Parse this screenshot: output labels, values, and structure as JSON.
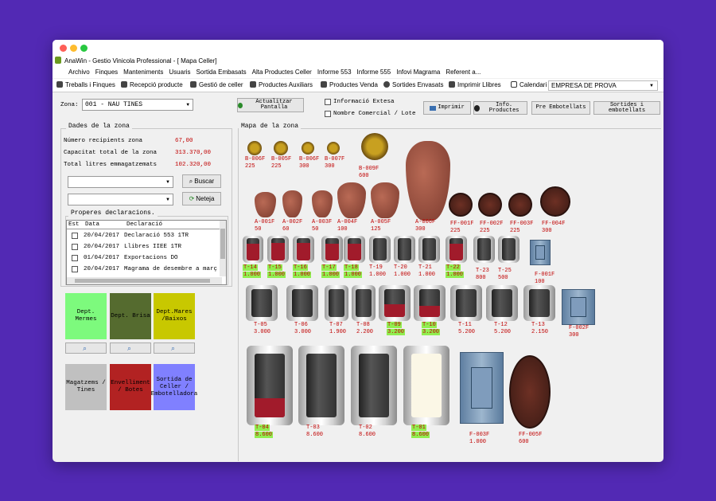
{
  "window": {
    "app_title": "AnaWin - Gestio Vinicola Professional - [  Mapa Celler]"
  },
  "menu": [
    "Archivo",
    "Finques",
    "Manteniments",
    "Usuaris",
    "Sortida Embasats",
    "Alta Productes Celler",
    "Informe 553",
    "Informe 555",
    "Infovi Magrama",
    "Referent a..."
  ],
  "toolbar": {
    "items": [
      "Treballs i Finques",
      "Recepció producte",
      "Gestió de celler",
      "Productes Auxiliars",
      "Productes Venda",
      "Sortides Envasats",
      "Imprimir Llibres",
      "Calendari"
    ],
    "company": "EMPRESA DE PROVA"
  },
  "zone": {
    "label": "Zona:",
    "value": "001 - NAU TINES"
  },
  "actions": {
    "refresh": "Actualitzar Pantalla",
    "info_ext": "Informació Extesa",
    "trade_name": "Nombre Comercial / Lote",
    "print": "Imprimir",
    "info_products": "Info. Productes",
    "pre_bottled": "Pre Embotellats",
    "bottled_out": "Sortides i embotellats"
  },
  "zone_data": {
    "title": "Dades de la zona",
    "rows": [
      {
        "label": "Número recipients zona",
        "value": "67,00"
      },
      {
        "label": "Capacitat total de la zona",
        "value": "313.370,00"
      },
      {
        "label": "Total litres emmagatzemats",
        "value": "102.320,00"
      }
    ]
  },
  "search": {
    "find": "Buscar",
    "clear": "Neteja"
  },
  "declarations": {
    "title": "Properes declaracions.",
    "headers": [
      "Est",
      "Data",
      "Declaració"
    ],
    "rows": [
      {
        "date": "20/04/2017",
        "name": "Declaració 553 1TR"
      },
      {
        "date": "20/04/2017",
        "name": "Llibres IIEE 1TR"
      },
      {
        "date": "01/04/2017",
        "name": "Exportacions DO"
      },
      {
        "date": "20/04/2017",
        "name": "Magrama de desembre a març"
      }
    ]
  },
  "departments": [
    {
      "label": "Dept. Mermes",
      "color": "#7dfa7d"
    },
    {
      "label": "Dept. Brisa",
      "color": "#556b2f"
    },
    {
      "label": "Dept.Mares /Baixos",
      "color": "#c8c800"
    },
    {
      "label": "Magatzems / Tines",
      "color": "#c0c0c0"
    },
    {
      "label": "Envelliment / Botes",
      "color": "#b22222"
    },
    {
      "label": "Sortida de Celler / Embotelladora",
      "color": "#8080ff"
    }
  ],
  "map": {
    "title": "Mapa de la zona",
    "pots": [
      {
        "name": "B-006F",
        "cap": "225"
      },
      {
        "name": "B-005F",
        "cap": "225"
      },
      {
        "name": "B-006F",
        "cap": "300"
      },
      {
        "name": "B-007F",
        "cap": "300"
      },
      {
        "name": "B-009F",
        "cap": "600"
      }
    ],
    "amphorae": [
      {
        "name": "A-001F",
        "cap": "50"
      },
      {
        "name": "A-002F",
        "cap": "60"
      },
      {
        "name": "A-003F",
        "cap": "50"
      },
      {
        "name": "A-004F",
        "cap": "100"
      },
      {
        "name": "A-005F",
        "cap": "125"
      },
      {
        "name": "A-006F",
        "cap": "300"
      }
    ],
    "barrels_top": [
      {
        "name": "FF-001F",
        "cap": "225"
      },
      {
        "name": "FF-002F",
        "cap": "225"
      },
      {
        "name": "FF-003F",
        "cap": "225"
      },
      {
        "name": "FF-004F",
        "cap": "300"
      }
    ],
    "row3": [
      {
        "name": "T-14",
        "cap": "1.000",
        "hl": true
      },
      {
        "name": "T-15",
        "cap": "1.000",
        "hl": true
      },
      {
        "name": "T-16",
        "cap": "1.000",
        "hl": true
      },
      {
        "name": "T-17",
        "cap": "1.000",
        "hl": true
      },
      {
        "name": "T-18",
        "cap": "1.000",
        "hl": true
      },
      {
        "name": "T-19",
        "cap": "1.000",
        "hl": false
      },
      {
        "name": "T-20",
        "cap": "1.000",
        "hl": false
      },
      {
        "name": "T-21",
        "cap": "1.000",
        "hl": false
      },
      {
        "name": "T-22",
        "cap": "1.000",
        "hl": true
      },
      {
        "name": "T-23",
        "cap": "800",
        "hl": false
      },
      {
        "name": "T-25",
        "cap": "500",
        "hl": false
      },
      {
        "name": "F-001F",
        "cap": "100",
        "hl": false
      }
    ],
    "row4": [
      {
        "name": "T-05",
        "cap": "3.000",
        "hl": false
      },
      {
        "name": "T-06",
        "cap": "3.000",
        "hl": false
      },
      {
        "name": "T-07",
        "cap": "1.900",
        "hl": false
      },
      {
        "name": "T-08",
        "cap": "2.200",
        "hl": false
      },
      {
        "name": "T-09",
        "cap": "3.200",
        "hl": true
      },
      {
        "name": "T-10",
        "cap": "3.200",
        "hl": true
      },
      {
        "name": "T-11",
        "cap": "5.200",
        "hl": false
      },
      {
        "name": "T-12",
        "cap": "5.200",
        "hl": false
      },
      {
        "name": "T-13",
        "cap": "2.150",
        "hl": false
      },
      {
        "name": "F-002F",
        "cap": "300",
        "hl": false
      }
    ],
    "row5": [
      {
        "name": "T-04",
        "cap": "8.600",
        "hl": true
      },
      {
        "name": "T-03",
        "cap": "8.600",
        "hl": false
      },
      {
        "name": "T-02",
        "cap": "8.600",
        "hl": false
      },
      {
        "name": "T-01",
        "cap": "8.600",
        "hl": true
      },
      {
        "name": "F-003F",
        "cap": "1.000",
        "hl": false
      },
      {
        "name": "FF-005F",
        "cap": "600",
        "hl": false
      }
    ]
  }
}
